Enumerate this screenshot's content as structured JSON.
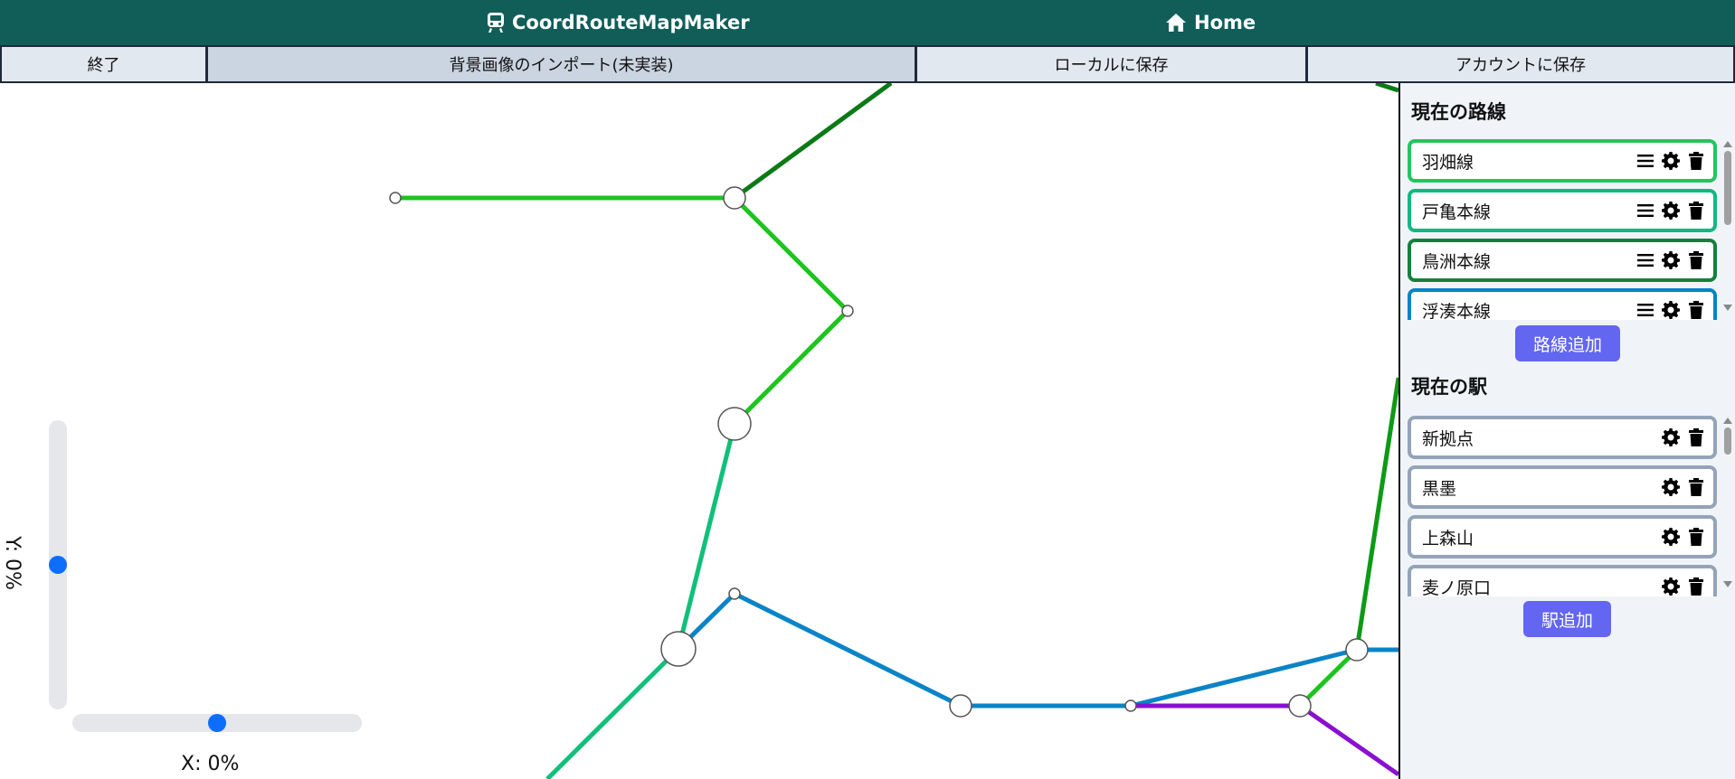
{
  "app": {
    "brand_label": "CoordRouteMapMaker",
    "home_label": "Home",
    "brand_icon": "train-icon",
    "home_icon": "home-icon",
    "header_color": "#115e59"
  },
  "toolbar": [
    {
      "label": "終了"
    },
    {
      "label": "背景画像のインポート(未実装)"
    },
    {
      "label": "ローカルに保存"
    },
    {
      "label": "アカウントに保存"
    }
  ],
  "sliders": {
    "y_label": "Y: 0%",
    "x_label": "X: 0%",
    "y_value": 0.5,
    "x_value": 0.5,
    "thumb_color": "#0d6efd"
  },
  "lines_panel": {
    "title": "現在の路線",
    "items": [
      {
        "name": "羽畑線",
        "color": "#22c55e"
      },
      {
        "name": "戸亀本線",
        "color": "#10b981"
      },
      {
        "name": "鳥洲本線",
        "color": "#15803d"
      },
      {
        "name": "浮湊本線",
        "color": "#0284c7"
      }
    ],
    "add_label": "路線追加"
  },
  "stations_panel": {
    "title": "現在の駅",
    "items": [
      {
        "name": "新拠点",
        "color": "#94a3b8"
      },
      {
        "name": "黒墨",
        "color": "#94a3b8"
      },
      {
        "name": "上森山",
        "color": "#94a3b8"
      },
      {
        "name": "麦ノ原口",
        "color": "#94a3b8"
      }
    ],
    "add_label": "駅追加"
  },
  "map": {
    "line_colors": {
      "light_green": "#1ec41e",
      "dark_green": "#0b7a16",
      "teal": "#10c07a",
      "blue": "#0a84c6",
      "purple": "#8a10d0"
    }
  }
}
